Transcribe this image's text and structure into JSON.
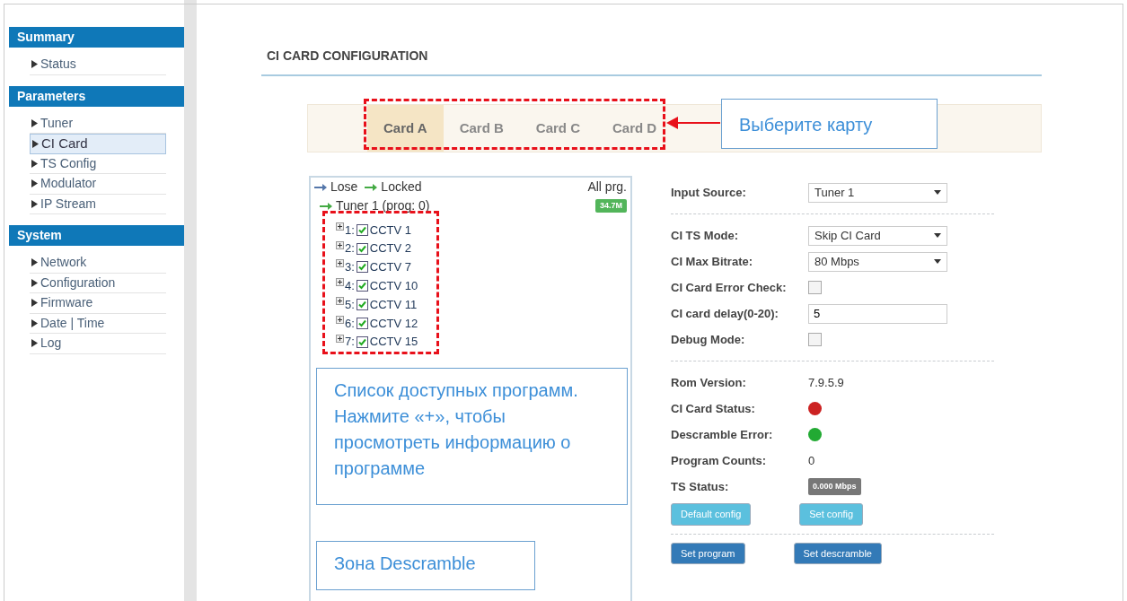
{
  "sidebar": [
    {
      "heading": "Summary",
      "items": [
        {
          "label": "Status",
          "selected": false
        }
      ]
    },
    {
      "heading": "Parameters",
      "items": [
        {
          "label": "Tuner",
          "selected": false
        },
        {
          "label": "CI Card",
          "selected": true
        },
        {
          "label": "TS Config",
          "selected": false
        },
        {
          "label": "Modulator",
          "selected": false
        },
        {
          "label": "IP Stream",
          "selected": false
        }
      ]
    },
    {
      "heading": "System",
      "items": [
        {
          "label": "Network",
          "selected": false
        },
        {
          "label": "Configuration",
          "selected": false
        },
        {
          "label": "Firmware",
          "selected": false
        },
        {
          "label": "Date | Time",
          "selected": false
        },
        {
          "label": "Log",
          "selected": false
        }
      ]
    }
  ],
  "page_title": "CI CARD CONFIGURATION",
  "tabs": [
    {
      "label": "Card A",
      "selected": true
    },
    {
      "label": "Card B",
      "selected": false
    },
    {
      "label": "Card C",
      "selected": false
    },
    {
      "label": "Card D",
      "selected": false
    }
  ],
  "tree": {
    "legend": [
      {
        "label": "Lose",
        "color": "#5577aa"
      },
      {
        "label": "Locked",
        "color": "#44aa44"
      }
    ],
    "all_programs": "All prg.",
    "tuner": {
      "label": "Tuner 1 (prog: 0)",
      "badge": "34.7M",
      "children": [
        {
          "number": "1:",
          "name": "CCTV 1",
          "checked": true
        },
        {
          "number": "2:",
          "name": "CCTV 2",
          "checked": true
        },
        {
          "number": "3:",
          "name": "CCTV 7",
          "checked": true
        },
        {
          "number": "4:",
          "name": "CCTV 10",
          "checked": true
        },
        {
          "number": "5:",
          "name": "CCTV 11",
          "checked": true
        },
        {
          "number": "6:",
          "name": "CCTV 12",
          "checked": true
        },
        {
          "number": "7:",
          "name": "CCTV 15",
          "checked": true
        }
      ]
    }
  },
  "settings_groups": [
    {
      "rows": [
        {
          "kind": "select",
          "label": "Input Source:",
          "value": "Tuner 1"
        }
      ]
    },
    {
      "rows": [
        {
          "kind": "select",
          "label": "CI TS Mode:",
          "value": "Skip CI Card"
        },
        {
          "kind": "select",
          "label": "CI Max Bitrate:",
          "value": "80 Mbps"
        },
        {
          "kind": "checkbox",
          "label": "CI Card Error Check:",
          "checked": false
        },
        {
          "kind": "text",
          "label": "CI card delay(0-20):",
          "value": "5"
        },
        {
          "kind": "checkbox",
          "label": "Debug Mode:",
          "checked": false
        }
      ]
    },
    {
      "rows": [
        {
          "kind": "value",
          "label": "Rom Version:",
          "value": "7.9.5.9"
        },
        {
          "kind": "dot",
          "label": "CI Card Status:",
          "color": "#cc2222"
        },
        {
          "kind": "dot",
          "label": "Descramble Error:",
          "color": "#22aa33"
        },
        {
          "kind": "value",
          "label": "Program Counts:",
          "value": "0"
        },
        {
          "kind": "badge",
          "label": "TS Status:",
          "value": "0.000 Mbps"
        }
      ],
      "buttons": [
        {
          "label": "Default config",
          "kind": "light"
        },
        {
          "label": "Set config",
          "kind": "light"
        }
      ]
    },
    {
      "buttons": [
        {
          "label": "Set program",
          "kind": "dark"
        },
        {
          "label": "Set descramble",
          "kind": "dark"
        }
      ]
    }
  ],
  "annotations": [
    {
      "text": "Выберите карту"
    },
    {
      "text": "Список доступных программ. Нажмите «+», чтобы просмотреть информацию о программе"
    },
    {
      "text": "Зона Descramble"
    }
  ]
}
